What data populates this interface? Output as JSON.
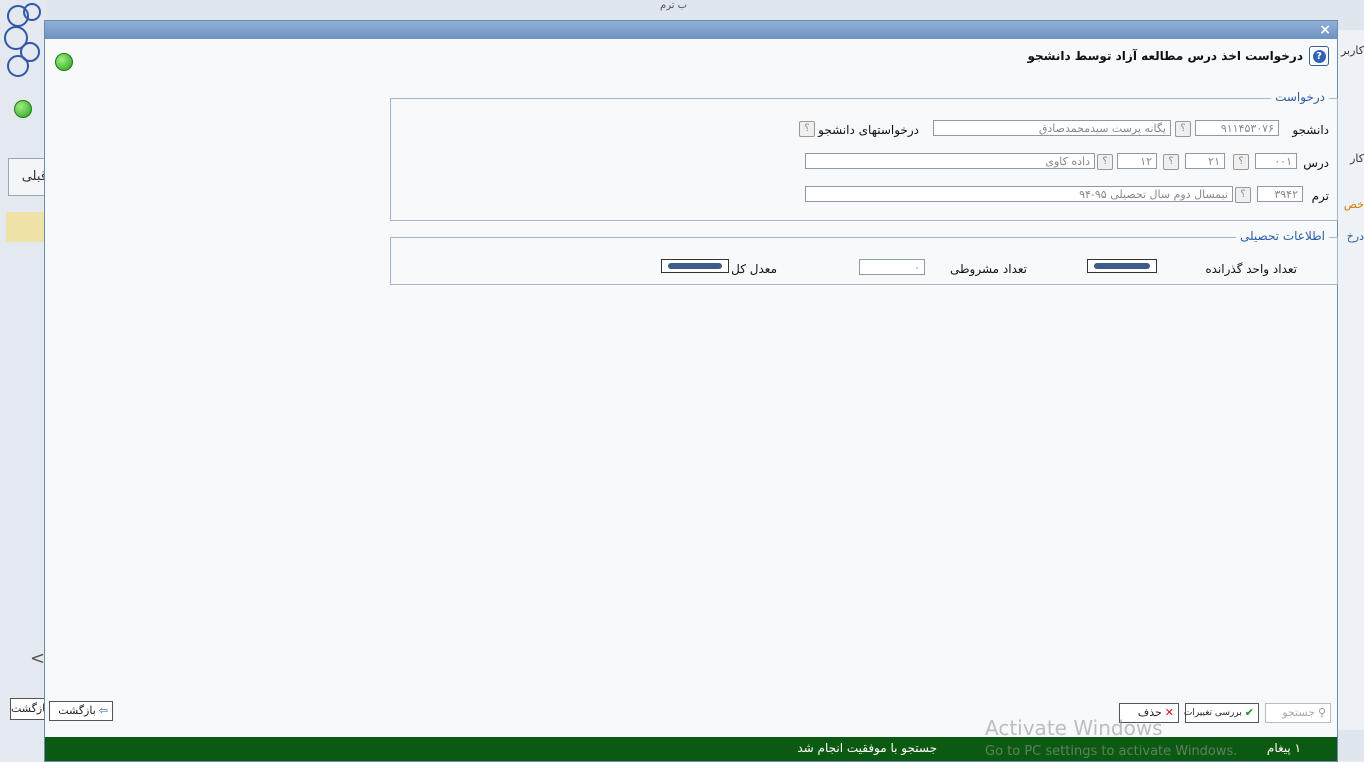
{
  "background": {
    "top_text": "ب ترم",
    "tab_label": "قبلی",
    "back_label": "بازگشت",
    "right_texts": [
      "کاربر",
      "کار",
      "خص",
      "درخ"
    ]
  },
  "dialog": {
    "close_icon": "×",
    "title": "درخواست اخذ درس مطالعه آزاد توسط دانشجو",
    "request_section": {
      "legend": "درخواست",
      "student_label": "دانشجو",
      "student_id": "۹۱۱۴۵۳۰۷۶",
      "student_name": "یگانه پرست سیدمحمدصادق",
      "student_requests_label": "درخواستهای دانشجو",
      "course_label": "درس",
      "course_code_1": "۰۰۱",
      "course_code_2": "۲۱",
      "course_code_3": "۱۲",
      "course_name": "داده کاوی",
      "term_label": "ترم",
      "term_code": "۳۹۴۲",
      "term_name": "نیمسال دوم سال تحصیلی ۹۵-۹۴"
    },
    "academic_section": {
      "legend": "اطلاعات تحصیلی",
      "passed_units_label": "تعداد واحد گذرانده",
      "conditional_label": "تعداد مشروطی",
      "conditional_value": "۰",
      "gpa_label": "معدل کل"
    },
    "toolbar": {
      "search_label": "جستجو",
      "review_changes_label": "بررسی تغییرات",
      "delete_label": "حذف",
      "back_label": "بازگشت"
    },
    "status": {
      "message_count": "۱ پیغام",
      "message": "جستجو با موفقیت انجام شد"
    }
  },
  "watermark": {
    "line1": "Activate Windows",
    "line2": "Go to PC settings to activate Windows."
  }
}
